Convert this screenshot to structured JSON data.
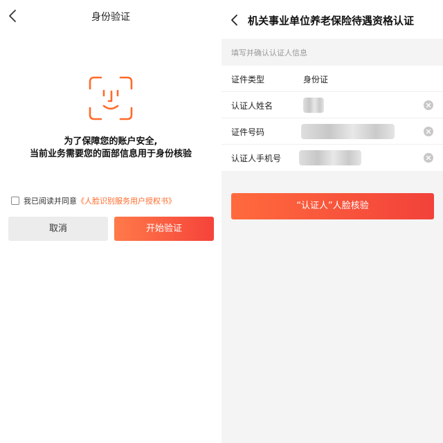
{
  "left": {
    "title": "身份验证",
    "notice_line1": "为了保障您的账户安全,",
    "notice_line2": "当前业务需要您的面部信息用于身份核验",
    "agree_text": "我已阅读并同意",
    "agree_link": "《人脸识别服务用户授权书》",
    "cancel_label": "取消",
    "start_label": "开始验证"
  },
  "right": {
    "title": "机关事业单位养老保险待遇资格认证",
    "section_hint": "填写并确认认证人信息",
    "rows": [
      {
        "label": "证件类型",
        "value": "身份证"
      },
      {
        "label": "认证人姓名",
        "value": ""
      },
      {
        "label": "证件号码",
        "value": ""
      },
      {
        "label": "认证人手机号",
        "value": ""
      }
    ],
    "verify_label": "“认证人”人脸核验"
  },
  "colors": {
    "accent": "#f5433a",
    "accent_light": "#ff7a4a",
    "link": "#ff6a2a",
    "face_icon": "#ff6a2a"
  },
  "icons": [
    "back-arrow-icon",
    "face-scan-icon",
    "clear-icon"
  ]
}
